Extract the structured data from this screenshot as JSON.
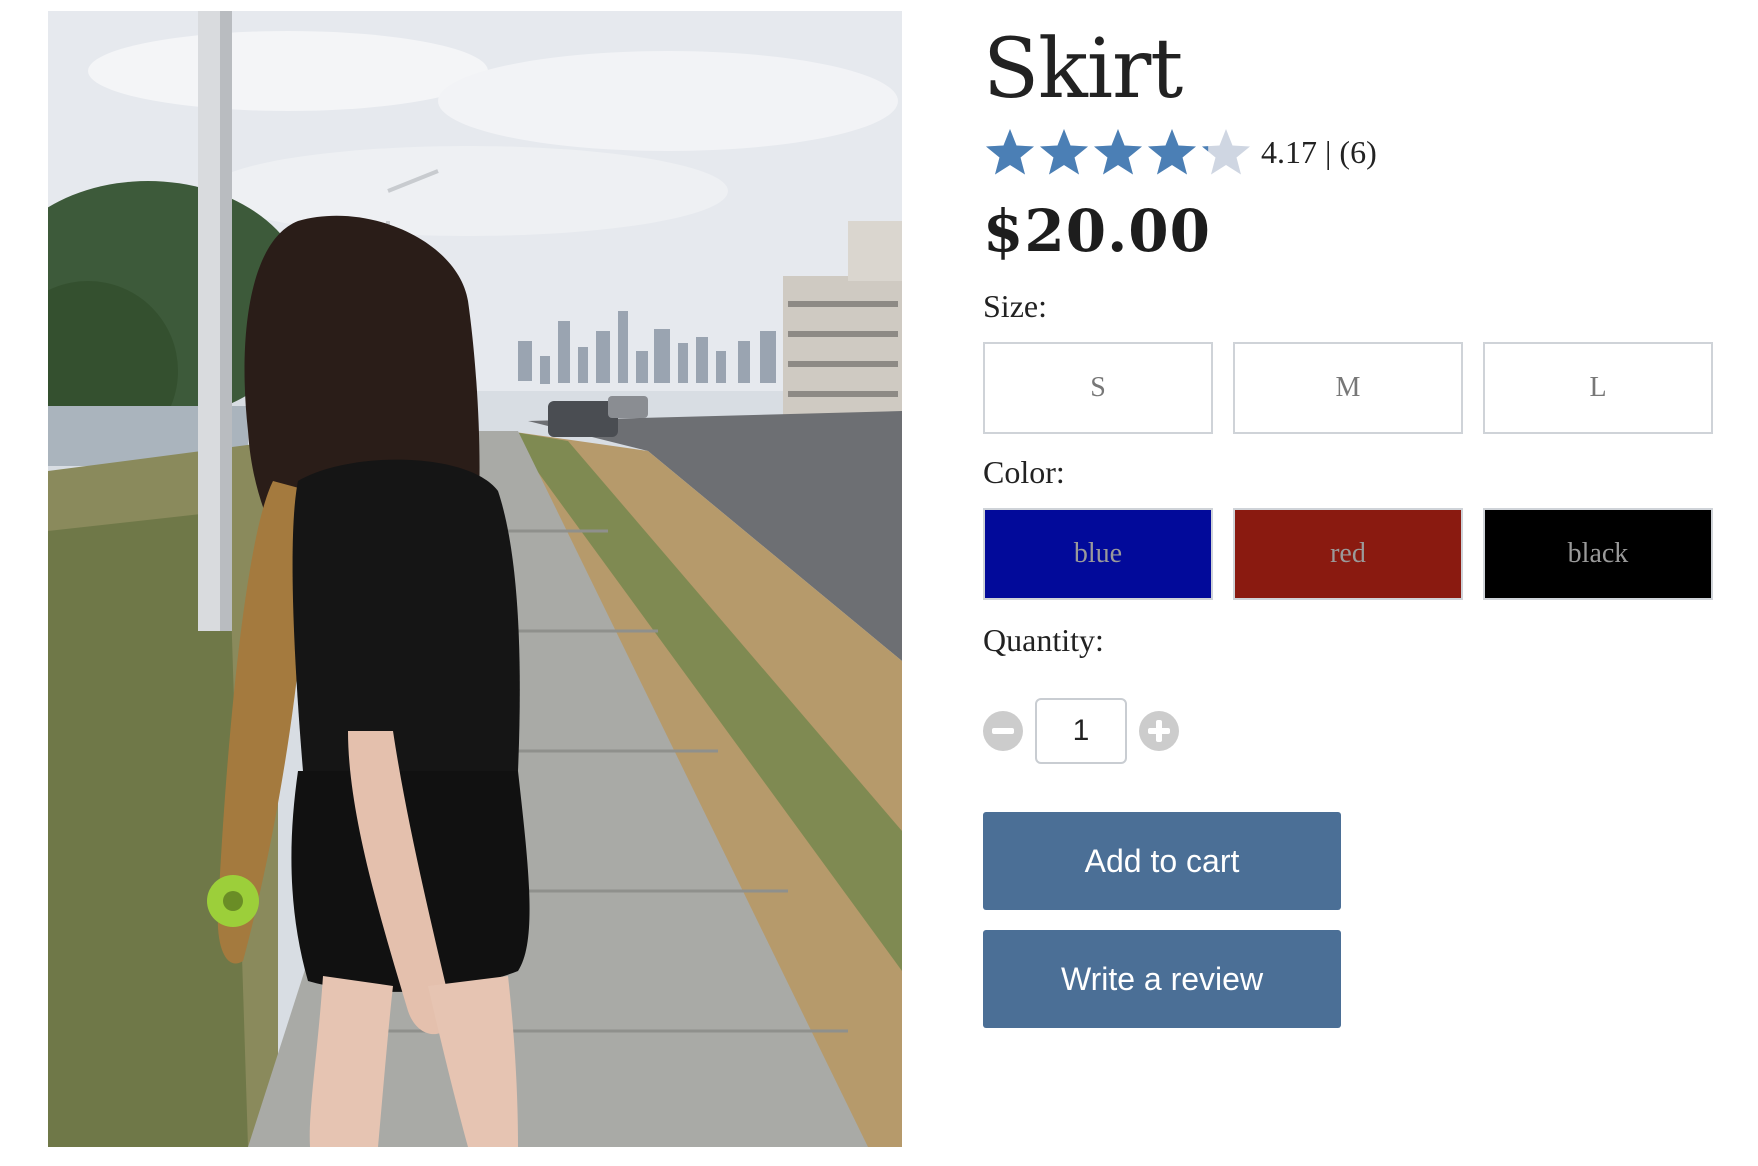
{
  "product": {
    "title": "Skirt",
    "rating": {
      "value": 4.17,
      "max": 5,
      "text": "4.17 | (6)",
      "filled_color": "#4b7fb5",
      "empty_color": "#cfd6e2"
    },
    "price": "$20.00",
    "image": {
      "icon": "product-photo"
    }
  },
  "size": {
    "label": "Size:",
    "options": [
      "S",
      "M",
      "L"
    ]
  },
  "color": {
    "label": "Color:",
    "options": [
      {
        "name": "blue",
        "hex": "#020a9a"
      },
      {
        "name": "red",
        "hex": "#8a1a10"
      },
      {
        "name": "black",
        "hex": "#000000"
      }
    ]
  },
  "quantity": {
    "label": "Quantity:",
    "value": "1",
    "decrement_icon": "minus-circle-icon",
    "increment_icon": "plus-circle-icon"
  },
  "actions": {
    "add_to_cart": "Add to cart",
    "write_review": "Write a review",
    "button_color": "#4b6f96"
  }
}
